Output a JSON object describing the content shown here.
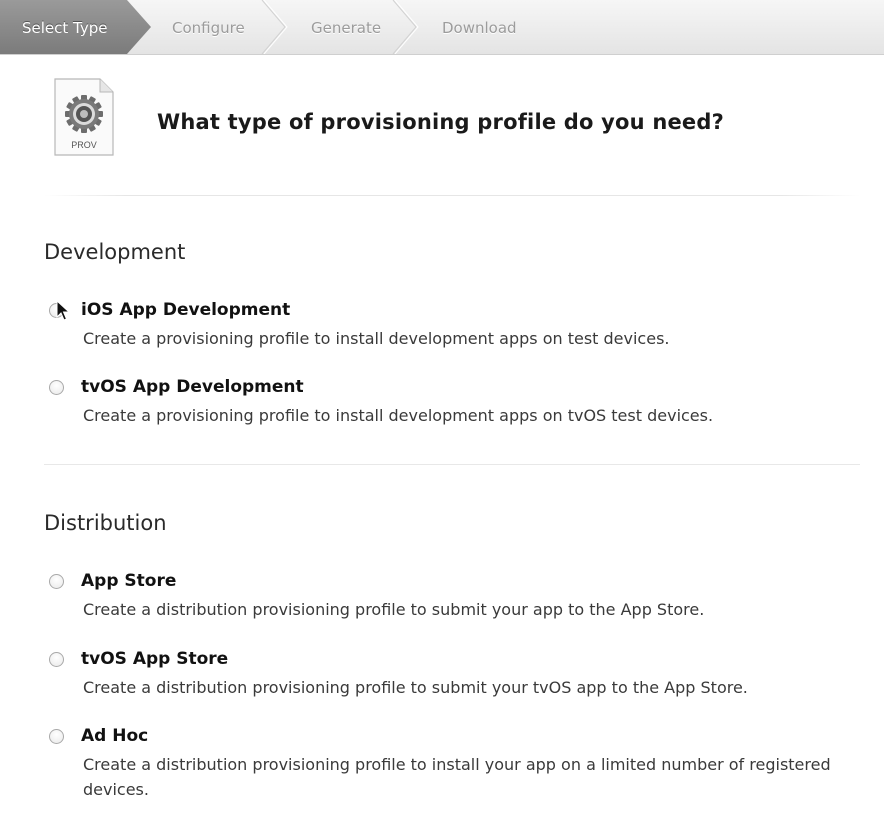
{
  "wizard": {
    "steps": [
      {
        "label": "Select Type",
        "active": true
      },
      {
        "label": "Configure",
        "active": false
      },
      {
        "label": "Generate",
        "active": false
      },
      {
        "label": "Download",
        "active": false
      }
    ]
  },
  "header": {
    "icon_label": "PROV",
    "title": "What type of provisioning profile do you need?"
  },
  "development": {
    "title": "Development",
    "options": [
      {
        "label": "iOS App Development",
        "description": "Create a provisioning profile to install development apps on test devices."
      },
      {
        "label": "tvOS App Development",
        "description": "Create a provisioning profile to install development apps on tvOS test devices."
      }
    ]
  },
  "distribution": {
    "title": "Distribution",
    "options": [
      {
        "label": "App Store",
        "description": "Create a distribution provisioning profile to submit your app to the App Store."
      },
      {
        "label": "tvOS App Store",
        "description": "Create a distribution provisioning profile to submit your tvOS app to the App Store."
      },
      {
        "label": "Ad Hoc",
        "description": "Create a distribution provisioning profile to install your app on a limited number of registered devices."
      }
    ]
  },
  "colors": {
    "active_step": "#8a8a8a",
    "inactive_step_text": "#9c9c9c",
    "title_text": "#1a1a1a"
  }
}
